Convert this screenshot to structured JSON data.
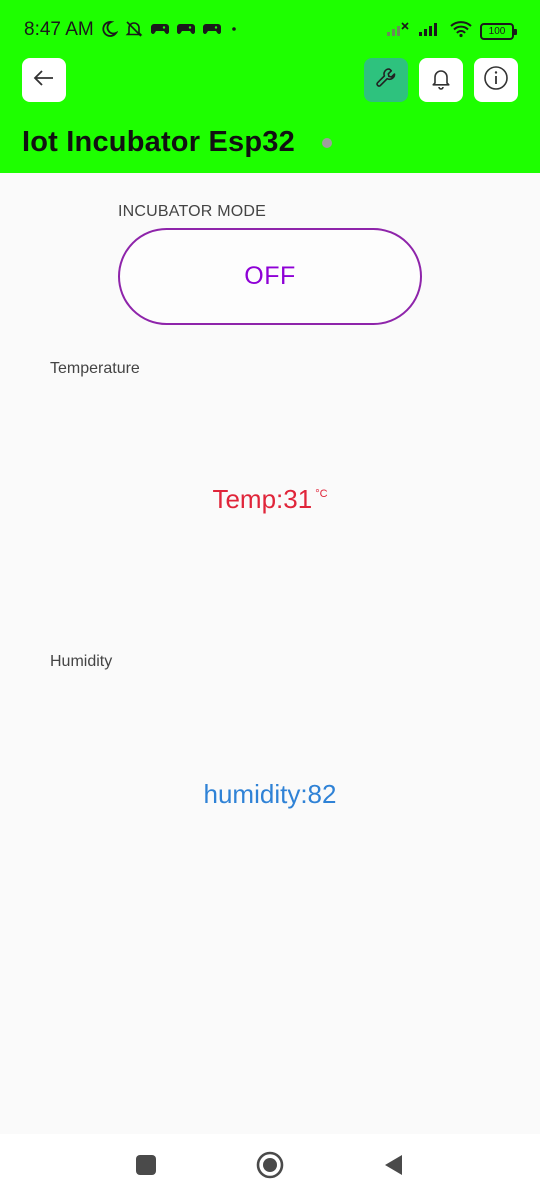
{
  "status_bar": {
    "time": "8:47 AM",
    "battery": "100",
    "icons_left": [
      "moon-icon",
      "muted-bell-icon",
      "game-controller-icon",
      "game-controller-icon",
      "game-controller-icon",
      "dot-icon"
    ],
    "icons_right": [
      "signal-no-service-icon",
      "signal-icon",
      "wifi-icon",
      "battery-icon"
    ]
  },
  "toolbar": {
    "back_icon": "arrow-left-icon",
    "wrench_icon": "wrench-icon",
    "bell_icon": "bell-icon",
    "info_icon": "info-icon"
  },
  "device": {
    "title": "Iot Incubator Esp32",
    "status": "offline"
  },
  "widgets": {
    "mode": {
      "label": "INCUBATOR MODE",
      "value": "OFF"
    },
    "temperature": {
      "label": "Temperature",
      "value": "Temp:31",
      "unit": "°C"
    },
    "humidity": {
      "label": "Humidity",
      "value": "humidity:82"
    }
  },
  "colors": {
    "header_bg": "#1eff00",
    "wrench_bg": "#2ec27e",
    "mode_border": "#8e24aa",
    "mode_text": "#8e00d6",
    "temp_text": "#e0253a",
    "humidity_text": "#2f82d6"
  },
  "nav_bar": [
    "recents-square-icon",
    "home-circle-icon",
    "back-triangle-icon"
  ]
}
